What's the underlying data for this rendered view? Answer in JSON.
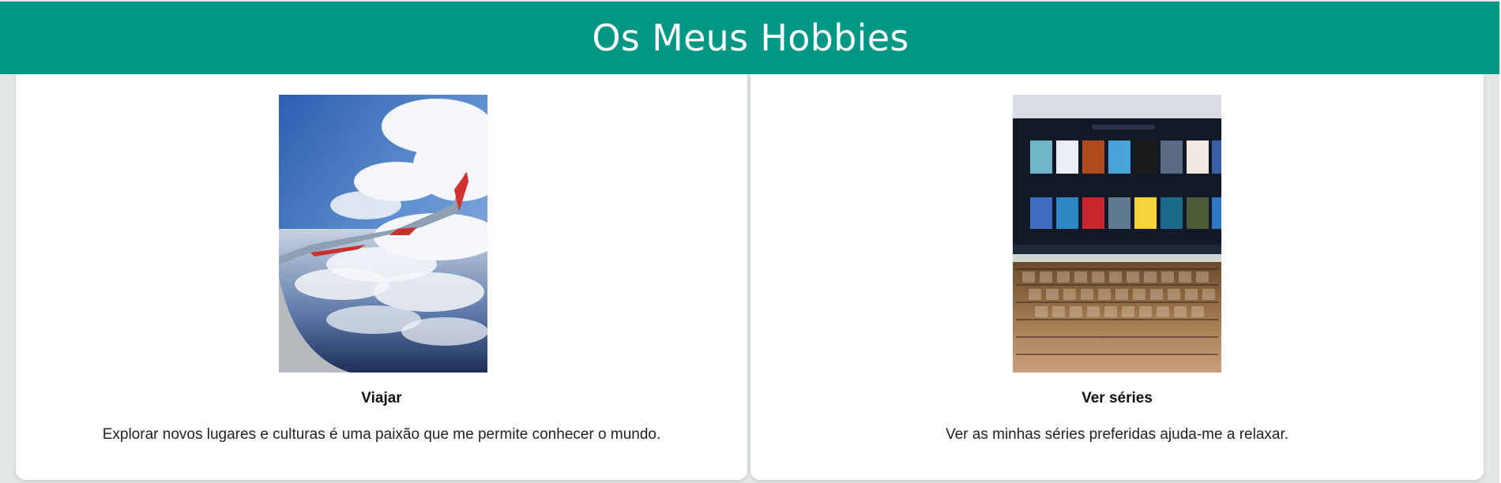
{
  "header": {
    "title": "Os Meus Hobbies"
  },
  "colors": {
    "header_bg": "#009785",
    "page_bg": "#e3e8e7",
    "card_bg": "#ffffff"
  },
  "hobbies": [
    {
      "title": "Viajar",
      "description": "Explorar novos lugares e culturas é uma paixão que me permite conhecer o mundo.",
      "image": "airplane-window-photo"
    },
    {
      "title": "Ver séries",
      "description": "Ver as minhas séries preferidas ajuda-me a relaxar.",
      "image": "laptop-series-photo"
    }
  ]
}
